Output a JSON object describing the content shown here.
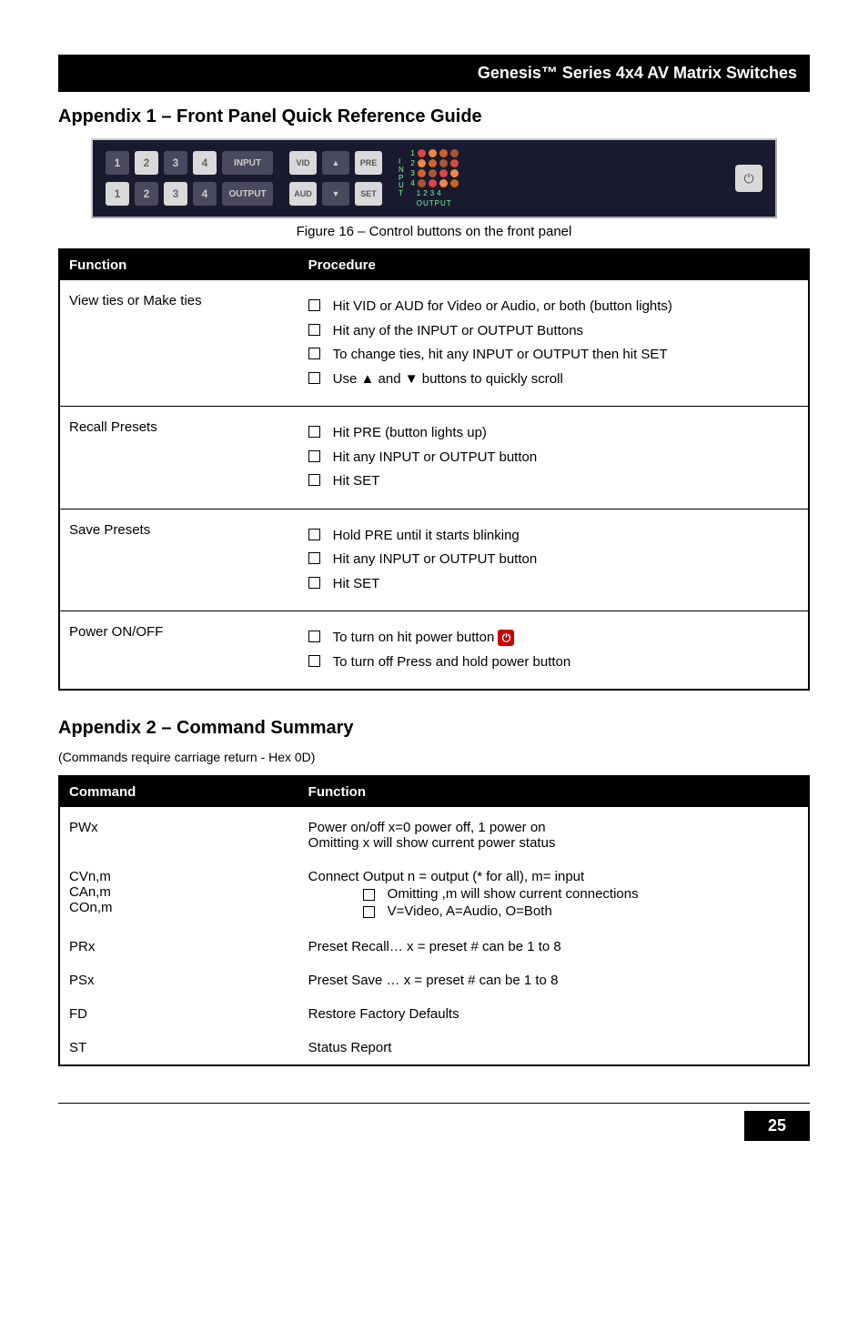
{
  "titlebar": "Genesis™ Series   4x4 AV Matrix Switches",
  "appendix1": {
    "heading": "Appendix 1 – Front Panel Quick Reference Guide",
    "panel": {
      "nums": [
        "1",
        "2",
        "3",
        "4"
      ],
      "input_label": "INPUT",
      "output_label": "OUTPUT",
      "vid": "VID",
      "pre": "PRE",
      "aud": "AUD",
      "set": "SET",
      "up": "▲",
      "down": "▼",
      "side_letters": [
        "I",
        "N",
        "P",
        "U",
        "T"
      ],
      "row_nums": [
        "1",
        "2",
        "3",
        "4"
      ],
      "led_cols": [
        "1",
        "2",
        "3",
        "4"
      ],
      "output_word": "OUTPUT",
      "power_glyph": "⏻"
    },
    "caption": "Figure 16 – Control buttons on the front panel",
    "table": {
      "headers": [
        "Function",
        "Procedure"
      ],
      "rows": [
        {
          "fn": "View ties or Make ties",
          "items": [
            "Hit VID or AUD for Video or Audio, or both (button lights)",
            "Hit any of the INPUT or OUTPUT Buttons",
            "To change ties, hit any INPUT or OUTPUT then hit SET",
            "Use ▲ and ▼ buttons to quickly scroll"
          ]
        },
        {
          "fn": "Recall Presets",
          "items": [
            "Hit PRE (button lights up)",
            "Hit any INPUT or OUTPUT button",
            "Hit SET"
          ]
        },
        {
          "fn": "Save Presets",
          "items": [
            "Hold PRE until it starts blinking",
            "Hit any INPUT or OUTPUT button",
            "Hit SET"
          ]
        },
        {
          "fn": "Power ON/OFF",
          "items": [
            "To turn on hit power button",
            "To turn off Press and hold power button"
          ],
          "power_icon_after_index": 0
        }
      ]
    }
  },
  "appendix2": {
    "heading": "Appendix 2 – Command Summary",
    "note": "(Commands require carriage return - Hex 0D)",
    "table": {
      "headers": [
        "Command",
        "Function"
      ],
      "rows": [
        {
          "cmd_lines": [
            "PWx"
          ],
          "desc_lines": [
            "Power on/off  x=0 power off, 1 power on",
            "Omitting x will show current power status"
          ]
        },
        {
          "cmd_lines": [
            "CVn,m",
            "CAn,m",
            "COn,m"
          ],
          "desc_head": "Connect Output    n = output (* for all), m= input",
          "desc_nested": [
            "Omitting ,m will show current connections",
            "V=Video, A=Audio, O=Both"
          ]
        },
        {
          "cmd_lines": [
            "PRx"
          ],
          "desc_lines": [
            "Preset Recall…  x = preset # can be 1 to 8"
          ]
        },
        {
          "cmd_lines": [
            "PSx"
          ],
          "desc_lines": [
            "Preset Save    …  x = preset # can be 1 to 8"
          ]
        },
        {
          "cmd_lines": [
            "FD"
          ],
          "desc_lines": [
            "Restore Factory Defaults"
          ]
        },
        {
          "cmd_lines": [
            "ST"
          ],
          "desc_lines": [
            "Status Report"
          ]
        }
      ]
    }
  },
  "page_number": "25"
}
